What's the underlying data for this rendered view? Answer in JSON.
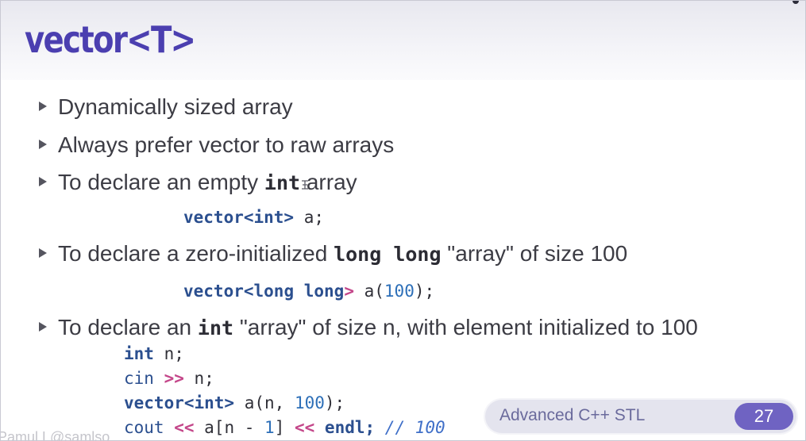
{
  "slide": {
    "title": "vector<T>",
    "bullets": [
      {
        "text": "Dynamically sized array"
      },
      {
        "text": "Always prefer vector to raw arrays"
      },
      {
        "pre": "To declare an empty ",
        "kw": "int",
        "post": " array"
      },
      {
        "pre": "To declare a zero-initialized ",
        "kw": "long long",
        "post": "  \"array\" of size 100"
      },
      {
        "pre": "To declare an ",
        "kw": "int",
        "post": " \"array\" of size n, with element initialized to 100"
      }
    ],
    "code1": {
      "type": "vector<int>",
      "rest": " a;"
    },
    "code2": {
      "type_a": "vector<",
      "type_b": "long long",
      "type_c": ">",
      "ident": " a(",
      "num": "100",
      "end": ");"
    },
    "code3": {
      "line1_kw": "int",
      "line1_rest": " n;",
      "line2_kw": "cin",
      "line2_op": " >>",
      "line2_rest": " n;",
      "line3_kw": "vector<int>",
      "line3_rest": " a(n, ",
      "line3_num": "100",
      "line3_end": ");",
      "line4_kw": "cout",
      "line4_op1": " <<",
      "line4_mid": " a[n - ",
      "line4_num": "1",
      "line4_mid2": "] ",
      "line4_op2": "<<",
      "line4_end": " endl; ",
      "line4_comment": "// 100"
    },
    "footer": {
      "label": "Advanced C++ STL",
      "page": "27"
    },
    "watermark": "Pamul L@samlso"
  },
  "colors": {
    "title": "#4b3fb0",
    "page_badge": "#6f63c2",
    "code_type": "#2b4f8f",
    "code_operator": "#c4478a"
  }
}
